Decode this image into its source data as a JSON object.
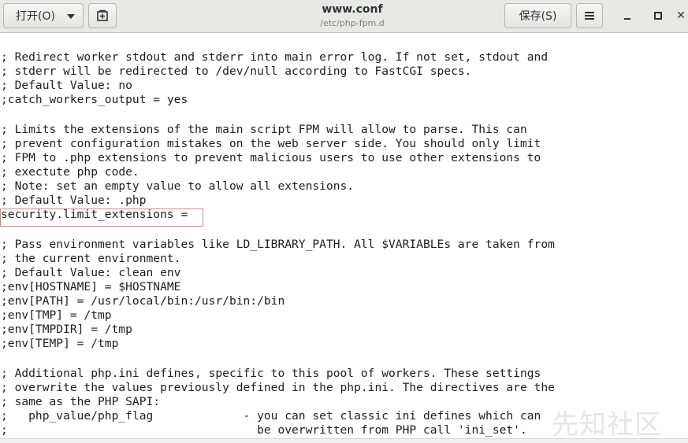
{
  "header": {
    "open_label": "打开(O)",
    "save_label": "保存(S)",
    "title": "www.conf",
    "subtitle": "/etc/php-fpm.d"
  },
  "editor": {
    "lines": [
      "; Redirect worker stdout and stderr into main error log. If not set, stdout and",
      "; stderr will be redirected to /dev/null according to FastCGI specs.",
      "; Default Value: no",
      ";catch_workers_output = yes",
      "",
      "; Limits the extensions of the main script FPM will allow to parse. This can",
      "; prevent configuration mistakes on the web server side. You should only limit",
      "; FPM to .php extensions to prevent malicious users to use other extensions to",
      "; exectute php code.",
      "; Note: set an empty value to allow all extensions.",
      "; Default Value: .php",
      "security.limit_extensions =",
      "",
      "; Pass environment variables like LD_LIBRARY_PATH. All $VARIABLEs are taken from",
      "; the current environment.",
      "; Default Value: clean env",
      ";env[HOSTNAME] = $HOSTNAME",
      ";env[PATH] = /usr/local/bin:/usr/bin:/bin",
      ";env[TMP] = /tmp",
      ";env[TMPDIR] = /tmp",
      ";env[TEMP] = /tmp",
      "",
      "; Additional php.ini defines, specific to this pool of workers. These settings",
      "; overwrite the values previously defined in the php.ini. The directives are the",
      "; same as the PHP SAPI:",
      ";   php_value/php_flag             - you can set classic ini defines which can",
      ";                                    be overwritten from PHP call 'ini_set'."
    ]
  },
  "watermark": "先知社区",
  "icons": {
    "open_dropdown": "chevron-down-icon",
    "new_tab": "new-document-icon",
    "menu": "hamburger-menu-icon",
    "minimize": "minimize-icon",
    "maximize": "maximize-icon",
    "close": "close-icon"
  }
}
